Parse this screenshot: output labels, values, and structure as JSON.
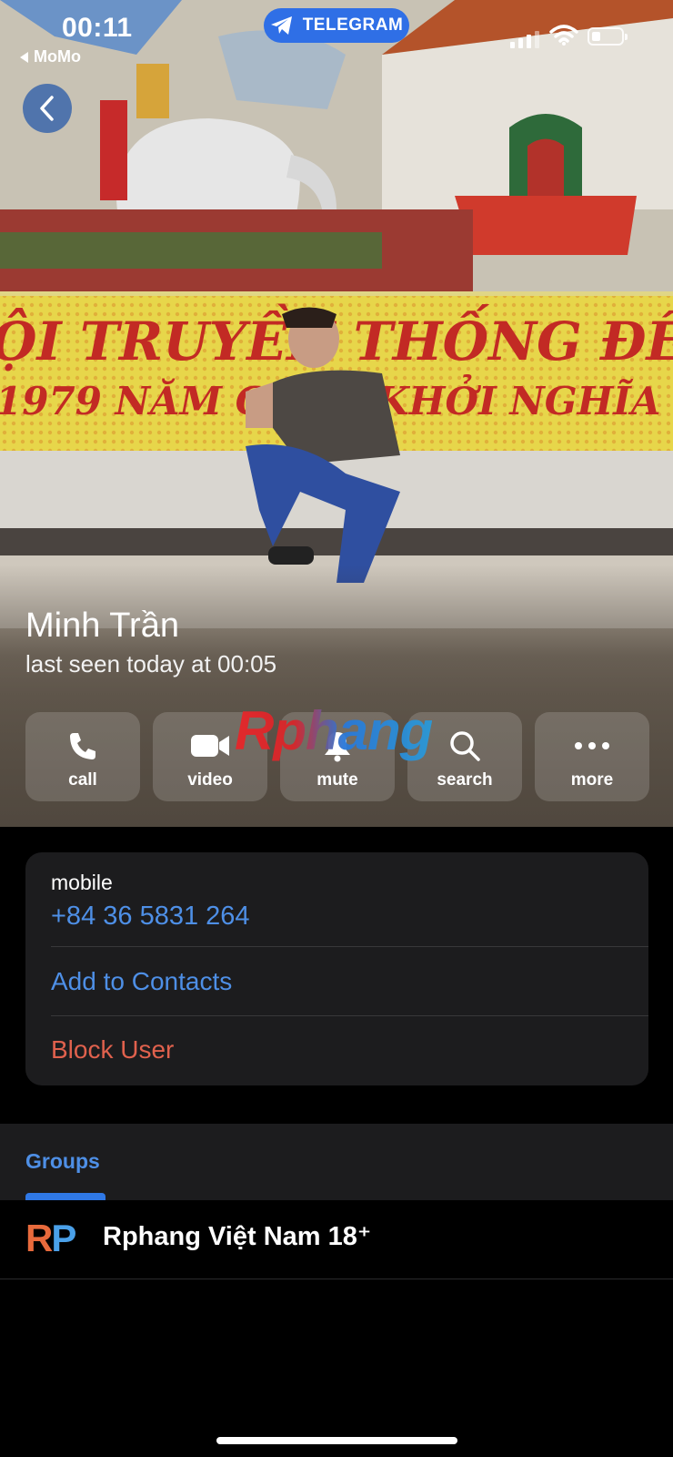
{
  "status_bar": {
    "time": "00:11",
    "back_app": "MoMo",
    "pill_label": "TELEGRAM"
  },
  "profile": {
    "name": "Minh Trần",
    "last_seen": "last seen today at 00:05"
  },
  "watermark": "Rphang",
  "actions": [
    {
      "label": "call",
      "icon": "phone-icon"
    },
    {
      "label": "video",
      "icon": "video-camera-icon"
    },
    {
      "label": "mute",
      "icon": "bell-icon"
    },
    {
      "label": "search",
      "icon": "search-icon"
    },
    {
      "label": "more",
      "icon": "more-dots-icon"
    }
  ],
  "info": {
    "mobile_label": "mobile",
    "phone": "+84 36 5831 264",
    "add_contacts": "Add to Contacts",
    "block_user": "Block User"
  },
  "groups": {
    "tab_label": "Groups",
    "items": [
      {
        "avatar_text": "RP",
        "title": "Rphang Việt Nam 18⁺"
      }
    ]
  },
  "colors": {
    "accent_blue": "#4e8fe6",
    "danger_red": "#e0614d",
    "telegram_pill": "#2f6fe6",
    "card_bg": "#1c1c1e"
  }
}
